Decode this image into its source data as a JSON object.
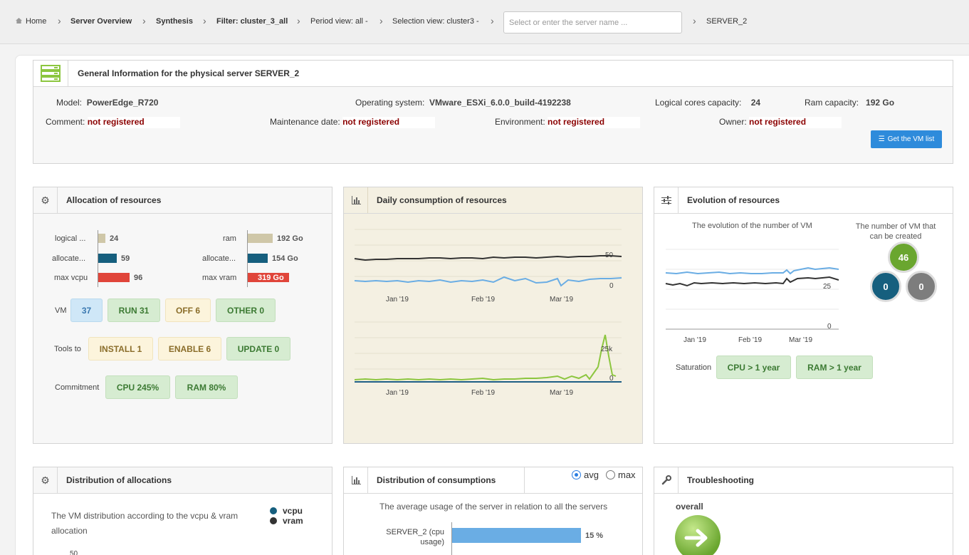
{
  "breadcrumb": {
    "home": "Home",
    "items": [
      "Server Overview",
      "Synthesis",
      "Filter: cluster_3_all",
      "Period view: all -",
      "Selection view: cluster3 -"
    ],
    "search_placeholder": "Select or enter the server name ...",
    "server": "SERVER_2"
  },
  "general": {
    "title": "General Information for the physical server SERVER_2",
    "model_label": "Model:",
    "model": "PowerEdge_R720",
    "os_label": "Operating system:",
    "os": "VMware_ESXi_6.0.0_build-4192238",
    "cores_label": "Logical cores capacity:",
    "cores": "24",
    "ram_label": "Ram capacity:",
    "ram": "192 Go",
    "comment_label": "Comment:",
    "comment": "not registered",
    "maint_label": "Maintenance date:",
    "maint": "not registered",
    "env_label": "Environment:",
    "env": "not registered",
    "owner_label": "Owner:",
    "owner": "not registered",
    "vm_list_button": "Get the VM list"
  },
  "allocation": {
    "title": "Allocation of resources",
    "rows_left": [
      {
        "label": "logical ...",
        "value": "24",
        "fill": 0.25,
        "color": "#cfc7a8"
      },
      {
        "label": "allocate...",
        "value": "59",
        "fill": 0.61,
        "color": "#165f7e"
      },
      {
        "label": "max vcpu",
        "value": "96",
        "fill": 1.0,
        "color": "#e0453a"
      }
    ],
    "rows_right": [
      {
        "label": "ram",
        "value": "192 Go",
        "fill": 1.0,
        "color": "#cfc7a8"
      },
      {
        "label": "allocate...",
        "value": "154 Go",
        "fill": 0.8,
        "color": "#165f7e"
      },
      {
        "label": "max vram",
        "value": "319 Go",
        "fill": 1.0,
        "color": "#e0453a"
      }
    ],
    "vm_label": "VM",
    "vm_total": "37",
    "vm_run": "RUN 31",
    "vm_off": "OFF 6",
    "vm_other": "OTHER 0",
    "tools_label": "Tools to",
    "tools_install": "INSTALL 1",
    "tools_enable": "ENABLE 6",
    "tools_update": "UPDATE 0",
    "commitment_label": "Commitment",
    "commit_cpu": "CPU 245%",
    "commit_ram": "RAM 80%"
  },
  "daily": {
    "title": "Daily consumption of resources",
    "months": [
      "Jan '19",
      "Feb '19",
      "Mar '19"
    ],
    "top_ticks": [
      "50",
      "0"
    ],
    "bottom_ticks": [
      "25k",
      "0"
    ]
  },
  "evolution": {
    "title": "Evolution of resources",
    "chart_title": "The evolution of the number of VM",
    "months": [
      "Jan '19",
      "Feb '19",
      "Mar '19"
    ],
    "ticks": [
      "25",
      "0"
    ],
    "created_title": "The number of VM that can be created",
    "created": [
      "46",
      "0",
      "0"
    ],
    "saturation_label": "Saturation",
    "sat_cpu": "CPU > 1 year",
    "sat_ram": "RAM > 1 year"
  },
  "dist_alloc": {
    "title": "Distribution of allocations",
    "text": "The VM distribution according to the vcpu & vram allocation",
    "legend": [
      "vcpu",
      "vram"
    ],
    "tick": "50"
  },
  "dist_cons": {
    "title": "Distribution of consumptions",
    "opt_avg": "avg",
    "opt_max": "max",
    "text": "The average usage of the server in relation to all the servers",
    "bar_label": "SERVER_2 (cpu usage)",
    "bar_value": "15 %"
  },
  "trouble": {
    "title": "Troubleshooting",
    "overall": "overall"
  },
  "colors": {
    "accent": "#2e8bdb",
    "dark": "#165f7e",
    "red": "#e0453a",
    "green_circle": "#6aa62f"
  }
}
